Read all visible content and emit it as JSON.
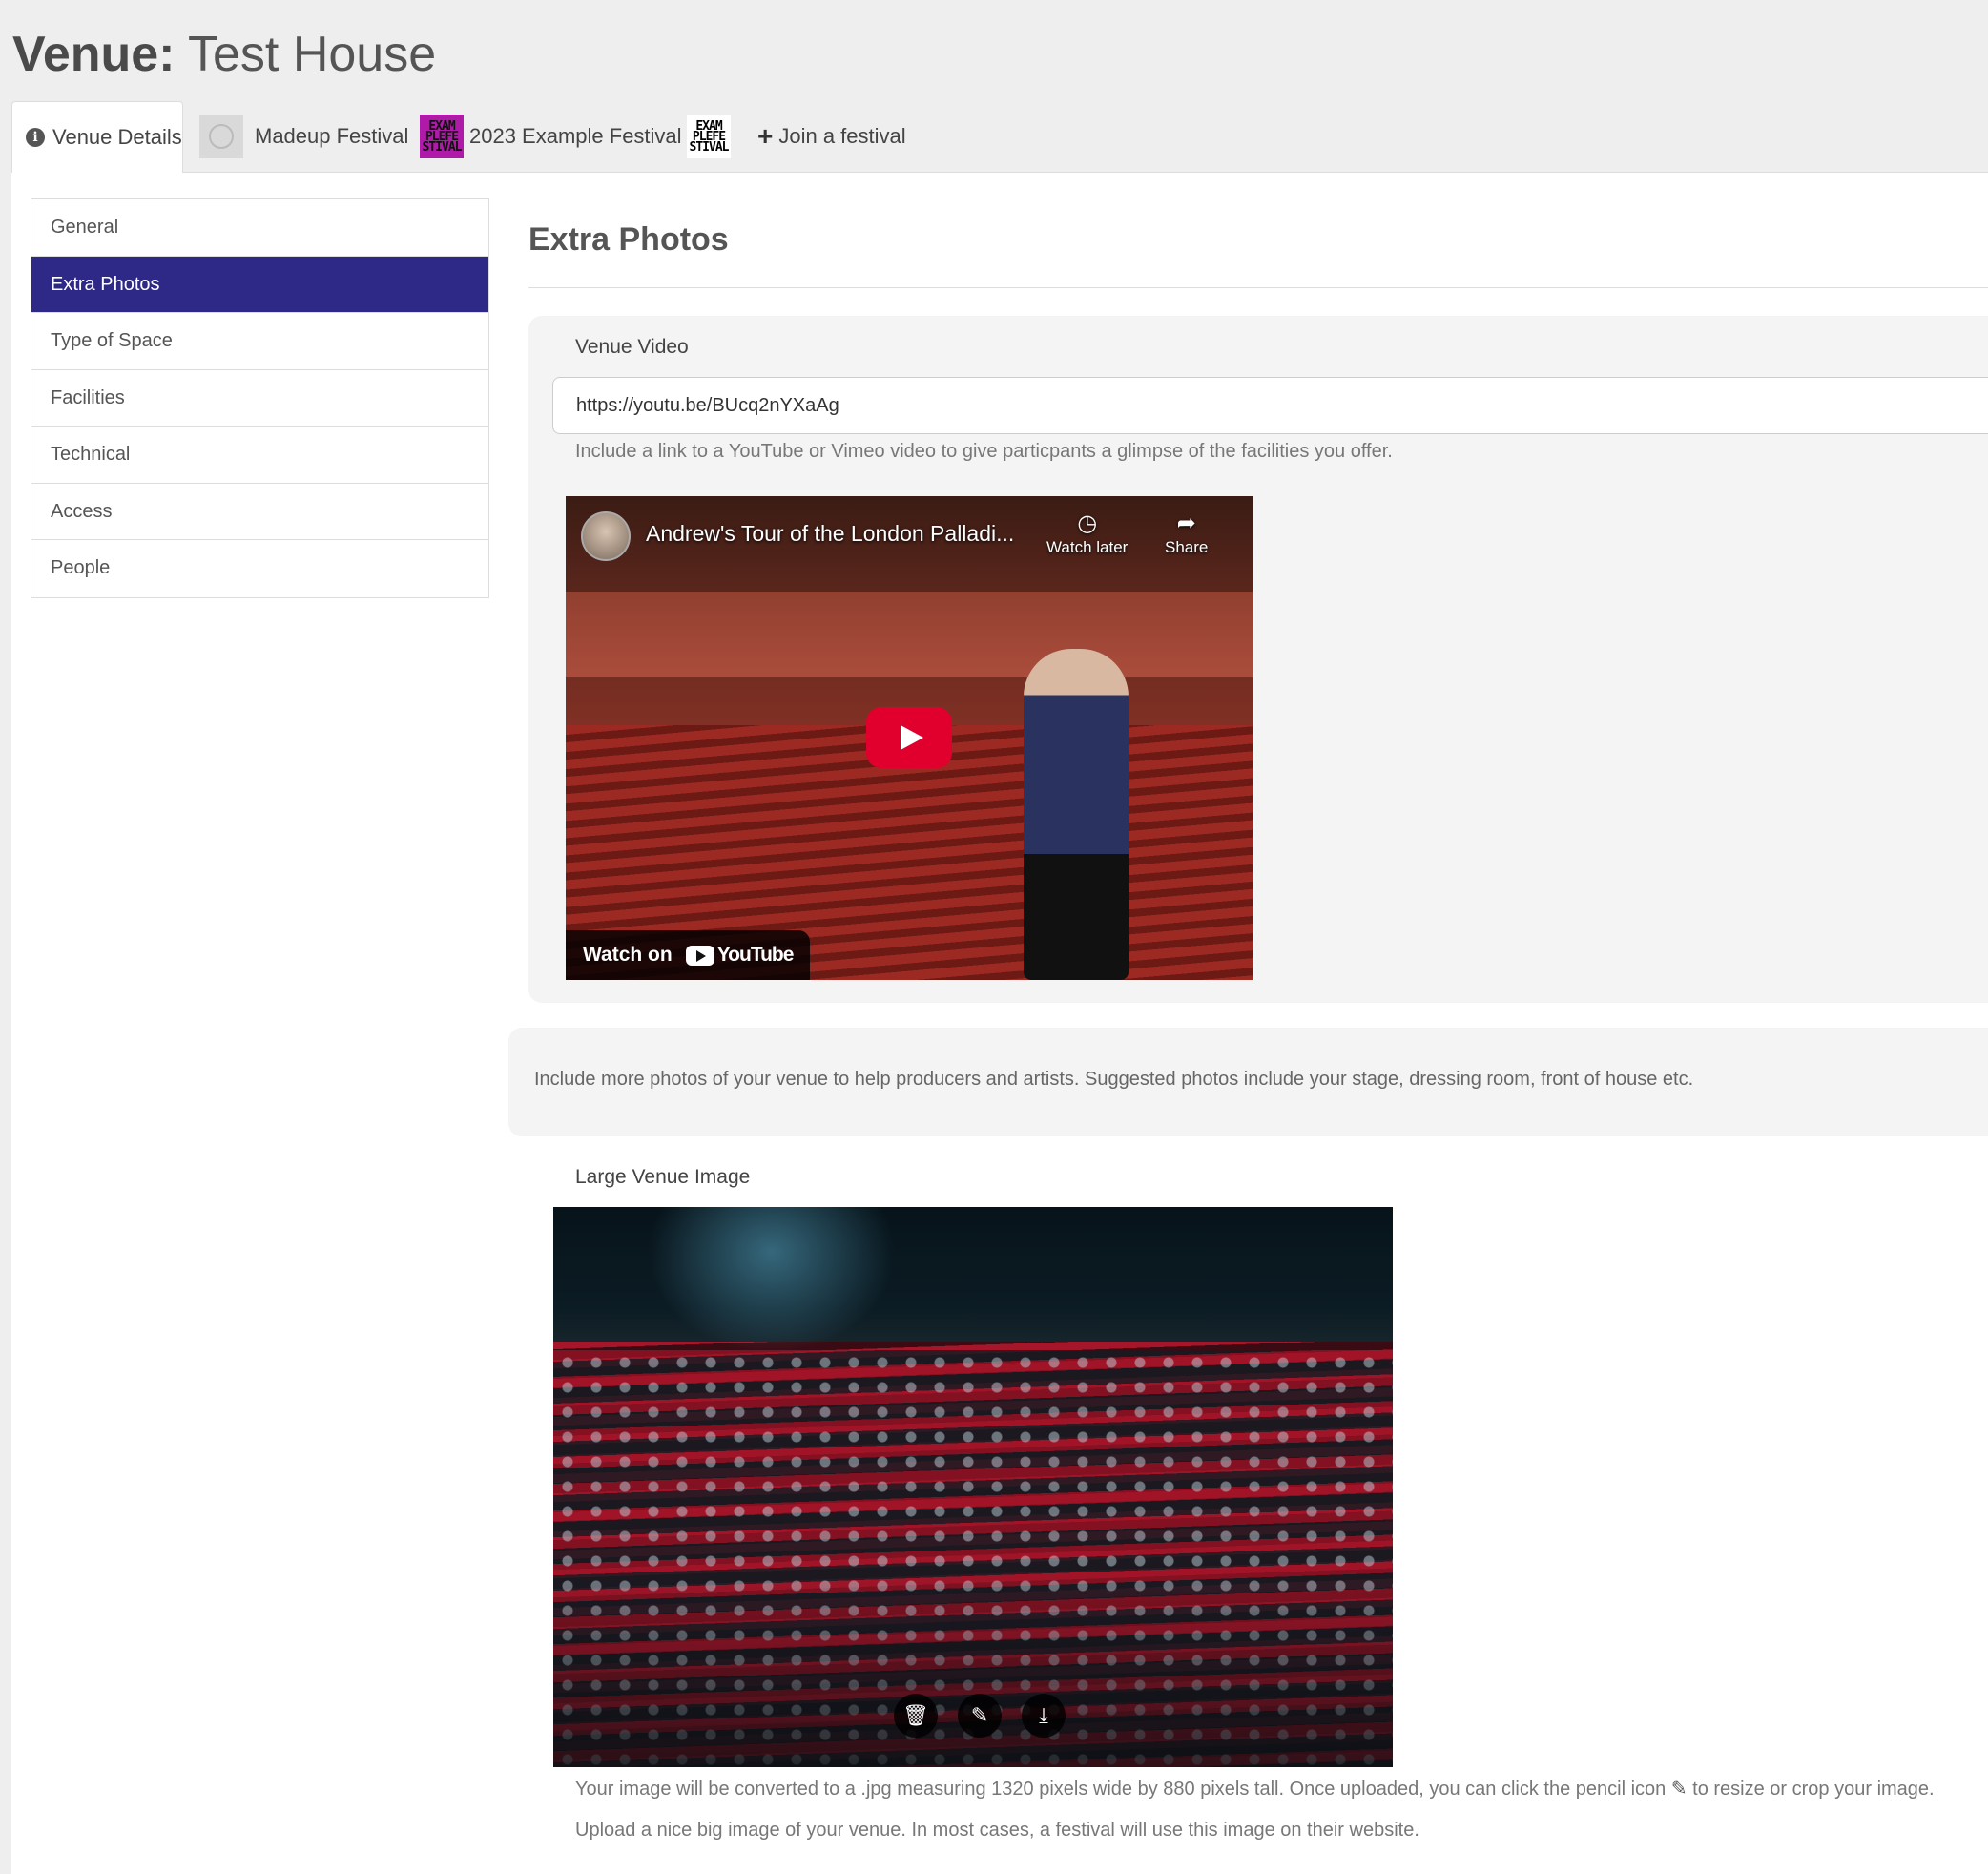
{
  "header": {
    "prefix": "Venue:",
    "name": "Test House"
  },
  "tabs": [
    {
      "label": "Venue Details",
      "icon": "info-circle-icon"
    },
    {
      "label": "Madeup Festival",
      "icon": "festival-logo-grey"
    },
    {
      "label": "2023 Example Festival",
      "icon": "festival-logo-pink",
      "logo_text": [
        "EXAM",
        "PLEFE",
        "STIVAL"
      ]
    },
    {
      "label": "",
      "icon": "festival-logo-bw",
      "logo_text": [
        "EXAM",
        "PLEFE",
        "STIVAL"
      ]
    },
    {
      "label": "Join a festival",
      "icon": "plus-icon"
    }
  ],
  "sidebar": {
    "items": [
      {
        "label": "General"
      },
      {
        "label": "Extra Photos"
      },
      {
        "label": "Type of Space"
      },
      {
        "label": "Facilities"
      },
      {
        "label": "Technical"
      },
      {
        "label": "Access"
      },
      {
        "label": "People"
      }
    ],
    "active_index": 1
  },
  "section": {
    "title": "Extra Photos"
  },
  "video": {
    "label": "Venue Video",
    "url": "https://youtu.be/BUcq2nYXaAg",
    "help": "Include a link to a YouTube or Vimeo video to give particpants a glimpse of the facilities you offer.",
    "embed": {
      "title": "Andrew's Tour of the London Palladi...",
      "watch_later": "Watch later",
      "share": "Share",
      "watch_on": "Watch on",
      "brand": "YouTube"
    }
  },
  "photos_info": "Include more photos of your venue to help producers and artists. Suggested photos include your stage, dressing room, front of house etc.",
  "large_image": {
    "label": "Large Venue Image",
    "help_before_icon": "Your image will be converted to a .jpg measuring 1320 pixels wide by 880 pixels tall. Once uploaded, you can click the pencil icon",
    "help_after_icon": "to resize or crop your image.",
    "help2": "Upload a nice big image of your venue. In most cases, a festival will use this image on their website."
  },
  "colors": {
    "accent": "#2e2886",
    "youtube_red": "#e1002d",
    "background": "#eeeeee"
  }
}
